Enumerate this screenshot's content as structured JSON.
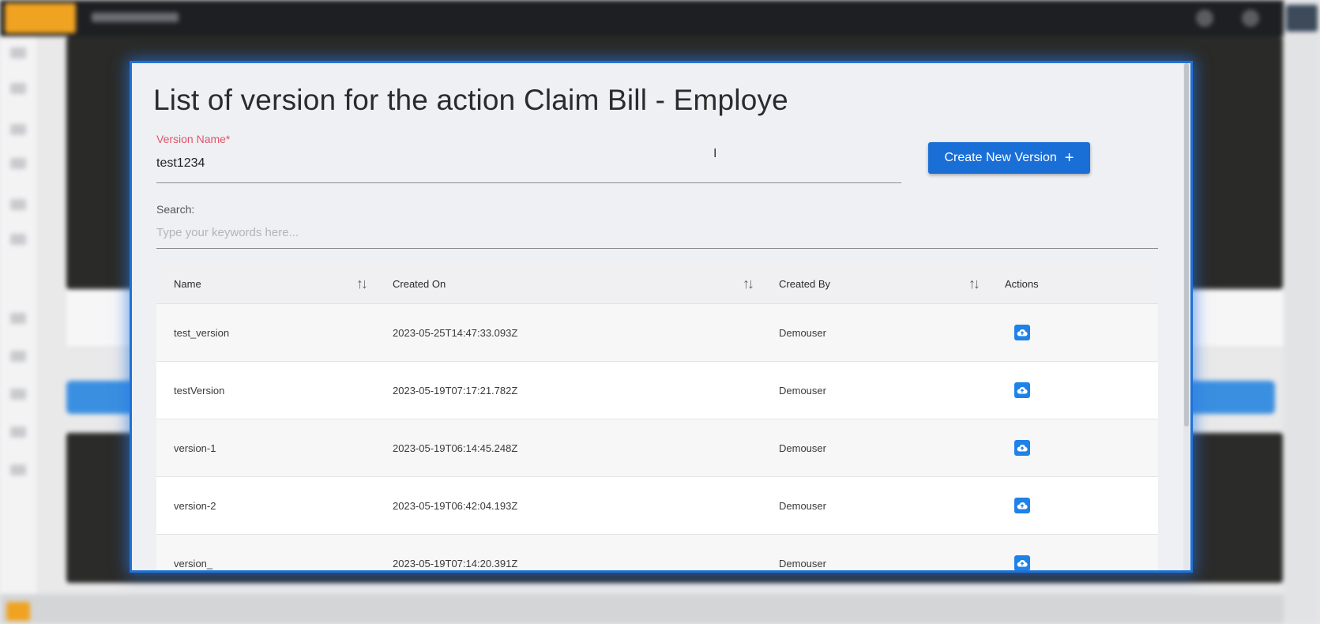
{
  "modal": {
    "title": "List of version for the action Claim Bill - Employe",
    "version_field": {
      "label": "Version Name*",
      "value": "test1234"
    },
    "create_button_label": "Create New Version",
    "search": {
      "label": "Search:",
      "placeholder": "Type your keywords here..."
    },
    "table": {
      "columns": [
        "Name",
        "Created On",
        "Created By",
        "Actions"
      ],
      "rows": [
        {
          "name": "test_version",
          "created_on": "2023-05-25T14:47:33.093Z",
          "created_by": "Demouser"
        },
        {
          "name": "testVersion",
          "created_on": "2023-05-19T07:17:21.782Z",
          "created_by": "Demouser"
        },
        {
          "name": "version-1",
          "created_on": "2023-05-19T06:14:45.248Z",
          "created_by": "Demouser"
        },
        {
          "name": "version-2",
          "created_on": "2023-05-19T06:42:04.193Z",
          "created_by": "Demouser"
        },
        {
          "name": "version_",
          "created_on": "2023-05-19T07:14:20.391Z",
          "created_by": "Demouser"
        }
      ],
      "action_icon": "cloud-upload-icon",
      "sort_icon": "sort-arrows-icon"
    }
  },
  "colors": {
    "primary": "#1a6fd6",
    "required_label": "#e25567",
    "modal_background": "#eef0f4"
  }
}
